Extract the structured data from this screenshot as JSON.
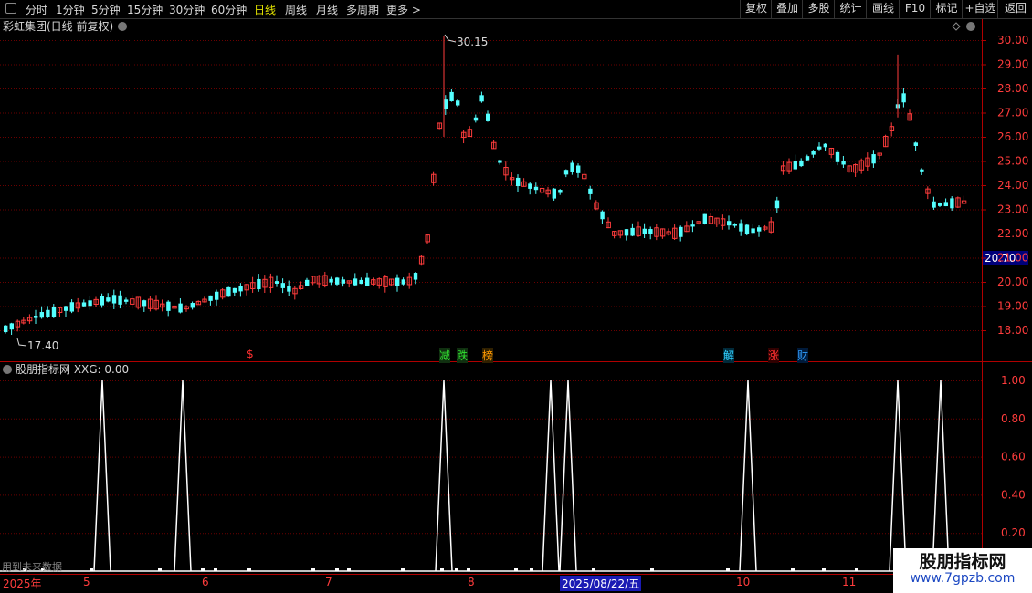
{
  "toolbar": {
    "periods": [
      "分时",
      "1分钟",
      "5分钟",
      "15分钟",
      "30分钟",
      "60分钟",
      "日线",
      "周线",
      "月线",
      "多周期",
      "更多 >"
    ],
    "active_period": "日线",
    "right_buttons": [
      "复权",
      "叠加",
      "多股",
      "统计",
      "画线",
      "F10",
      "标记",
      "+自选",
      "返回"
    ]
  },
  "main_chart": {
    "title": "彩虹集团(日线 前复权)",
    "price_axis_ticks": [
      "30.00",
      "29.00",
      "28.00",
      "27.00",
      "26.00",
      "25.00",
      "24.00",
      "23.00",
      "22.00",
      "21.00",
      "20.00",
      "19.00",
      "18.00"
    ],
    "current_price_label": "20.70",
    "high_label": "30.15",
    "low_label": "17.40",
    "markers": [
      {
        "text": "$",
        "color": "#ff3030"
      },
      {
        "text": "减",
        "color": "#30e030"
      },
      {
        "text": "跌",
        "color": "#30e030"
      },
      {
        "text": "榜",
        "color": "#ff9900"
      },
      {
        "text": "解",
        "color": "#30d0ff"
      },
      {
        "text": "涨",
        "color": "#ff3030"
      },
      {
        "text": "财",
        "color": "#30a0ff"
      }
    ]
  },
  "indicator": {
    "title": "股朋指标网 XXG: 0.00",
    "axis_ticks": [
      "1.00",
      "0.80",
      "0.60",
      "0.40",
      "0.20"
    ],
    "future_data_note": "用到未来数据",
    "signal_bars": [
      27,
      47,
      100,
      175,
      222,
      236,
      273,
      343,
      369,
      382,
      441,
      484,
      500,
      513,
      565,
      582,
      650,
      714,
      797,
      868,
      902,
      938
    ]
  },
  "chart_data": {
    "type": "candlestick+line",
    "x_axis_labels": [
      "2025年",
      "5",
      "6",
      "7",
      "8",
      "2025/08/22/五",
      "10",
      "11"
    ],
    "price_range": [
      17.0,
      30.5
    ],
    "price_high": 30.15,
    "price_low": 17.4,
    "indicator_range": [
      0,
      1.0
    ],
    "spikes": [
      112,
      200,
      486,
      603,
      622,
      819,
      983,
      1030
    ]
  },
  "watermark": {
    "title": "股朋指标网",
    "url": "www.7gpzb.com"
  },
  "colors": {
    "up": "#ff3c3c",
    "down": "#54ffff",
    "grid": "#7a0000",
    "axis_text": "#ff3c3c",
    "price_box": "#00007a",
    "date_highlight": "#1a1ab4"
  }
}
